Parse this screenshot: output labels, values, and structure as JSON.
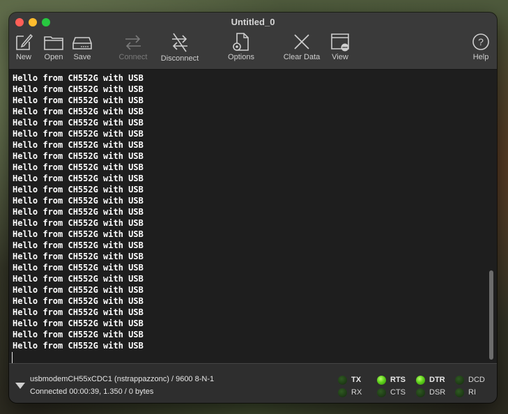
{
  "window": {
    "title": "Untitled_0"
  },
  "toolbar": {
    "new_label": "New",
    "open_label": "Open",
    "save_label": "Save",
    "connect_label": "Connect",
    "disconnect_label": "Disconnect",
    "options_label": "Options",
    "clear_label": "Clear Data",
    "view_label": "View",
    "help_label": "Help"
  },
  "terminal": {
    "lines": [
      "Hello from CH552G with USB",
      "Hello from CH552G with USB",
      "Hello from CH552G with USB",
      "Hello from CH552G with USB",
      "Hello from CH552G with USB",
      "Hello from CH552G with USB",
      "Hello from CH552G with USB",
      "Hello from CH552G with USB",
      "Hello from CH552G with USB",
      "Hello from CH552G with USB",
      "Hello from CH552G with USB",
      "Hello from CH552G with USB",
      "Hello from CH552G with USB",
      "Hello from CH552G with USB",
      "Hello from CH552G with USB",
      "Hello from CH552G with USB",
      "Hello from CH552G with USB",
      "Hello from CH552G with USB",
      "Hello from CH552G with USB",
      "Hello from CH552G with USB",
      "Hello from CH552G with USB",
      "Hello from CH552G with USB",
      "Hello from CH552G with USB",
      "Hello from CH552G with USB",
      "Hello from CH552G with USB",
      "Hello from CH552G with USB"
    ]
  },
  "status": {
    "port": "usbmodemCH55xCDC1 (nstrappazzonc) / 9600 8-N-1",
    "connection": "Connected 00:00:39, 1.350 / 0 bytes",
    "signals": {
      "tx": {
        "label": "TX",
        "on": false
      },
      "rx": {
        "label": "RX",
        "on": false
      },
      "rts": {
        "label": "RTS",
        "on": true
      },
      "cts": {
        "label": "CTS",
        "on": false
      },
      "dtr": {
        "label": "DTR",
        "on": true
      },
      "dsr": {
        "label": "DSR",
        "on": false
      },
      "dcd": {
        "label": "DCD",
        "on": false
      },
      "ri": {
        "label": "RI",
        "on": false
      }
    }
  },
  "colors": {
    "led_on": "#5fd11c",
    "led_off": "#1f3d16",
    "terminal_bg": "#1e1e1e",
    "terminal_text": "#ffffff"
  }
}
